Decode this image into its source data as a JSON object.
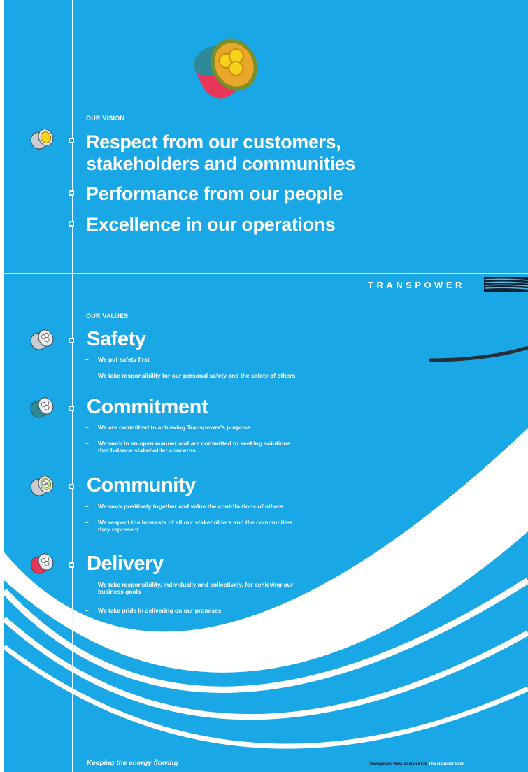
{
  "vision": {
    "label": "OUR VISION",
    "items": [
      "Respect from our customers,",
      "stakeholders and communities",
      "Performance from our people",
      "Excellence in our operations"
    ]
  },
  "brand": {
    "name": "TRANSPOWER"
  },
  "values": {
    "label": "OUR VALUES",
    "items": [
      {
        "title": "Safety",
        "points": [
          [
            "We put safety first"
          ],
          [
            "We take responsibility for our personal safety and the safety of others"
          ]
        ]
      },
      {
        "title": "Commitment",
        "points": [
          [
            "We are committed to achieving Transpower's purpose"
          ],
          [
            "We work in an open manner and are committed to seeking solutions",
            "that balance stakeholder concerns"
          ]
        ]
      },
      {
        "title": "Community",
        "points": [
          [
            "We work positively together and value the contributions of others"
          ],
          [
            "We respect the interests of all our stakeholders and the communities",
            "they represent"
          ]
        ]
      },
      {
        "title": "Delivery",
        "points": [
          [
            "We take responsibility, individually and collectively, for achieving our",
            "business goals"
          ],
          [
            "We take pride in delivering on our promises"
          ]
        ]
      }
    ]
  },
  "footer": {
    "tagline": "Keeping the energy flowing",
    "company": "Transpower New Zealand Ltd",
    "grid": "The National Grid"
  },
  "colors": {
    "background": "#1aa7e6",
    "text": "#ffffff",
    "cable_red": "#e8365a",
    "cable_teal": "#2e8a96",
    "cable_yellow": "#f6d21a",
    "cable_core": "#f2a424"
  }
}
